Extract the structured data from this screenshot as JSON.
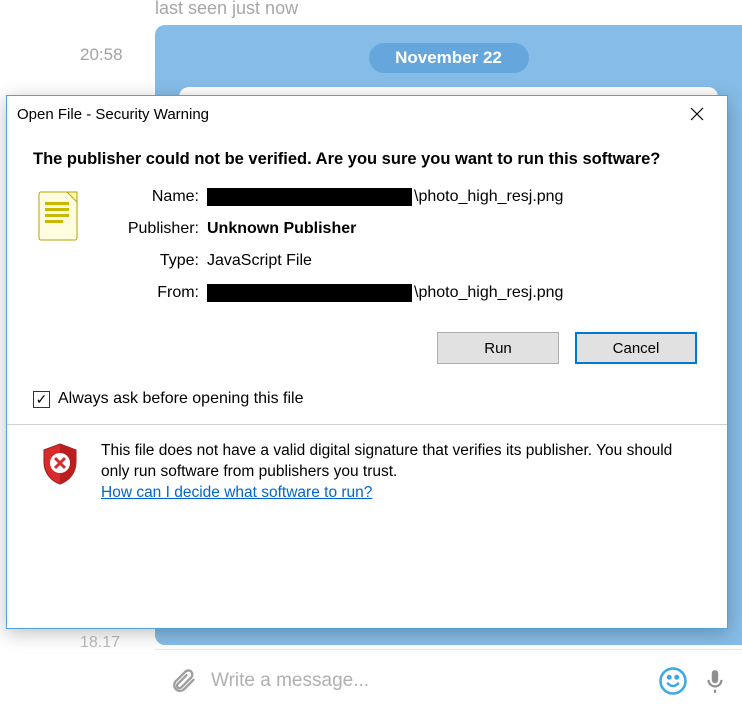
{
  "chat": {
    "partial_status": "last seen just now",
    "time": "20:58",
    "date_badge": "November 22",
    "bottom_time": "18.17",
    "message_placeholder": "Write a message..."
  },
  "dialog": {
    "title": "Open File - Security Warning",
    "heading": "The publisher could not be verified.  Are you sure you want to run this software?",
    "labels": {
      "name": "Name:",
      "publisher": "Publisher:",
      "type": "Type:",
      "from": "From:"
    },
    "values": {
      "name_suffix": "\\photo_high_resj.png",
      "publisher": "Unknown Publisher",
      "type": "JavaScript File",
      "from_suffix": "\\photo_high_resj.png"
    },
    "buttons": {
      "run": "Run",
      "cancel": "Cancel"
    },
    "checkbox_label": "Always ask before opening this file",
    "checkbox_checked": true,
    "footer_text": "This file does not have a valid digital signature that verifies its publisher.  You should only run software from publishers you trust.",
    "footer_link": "How can I decide what software to run?"
  }
}
